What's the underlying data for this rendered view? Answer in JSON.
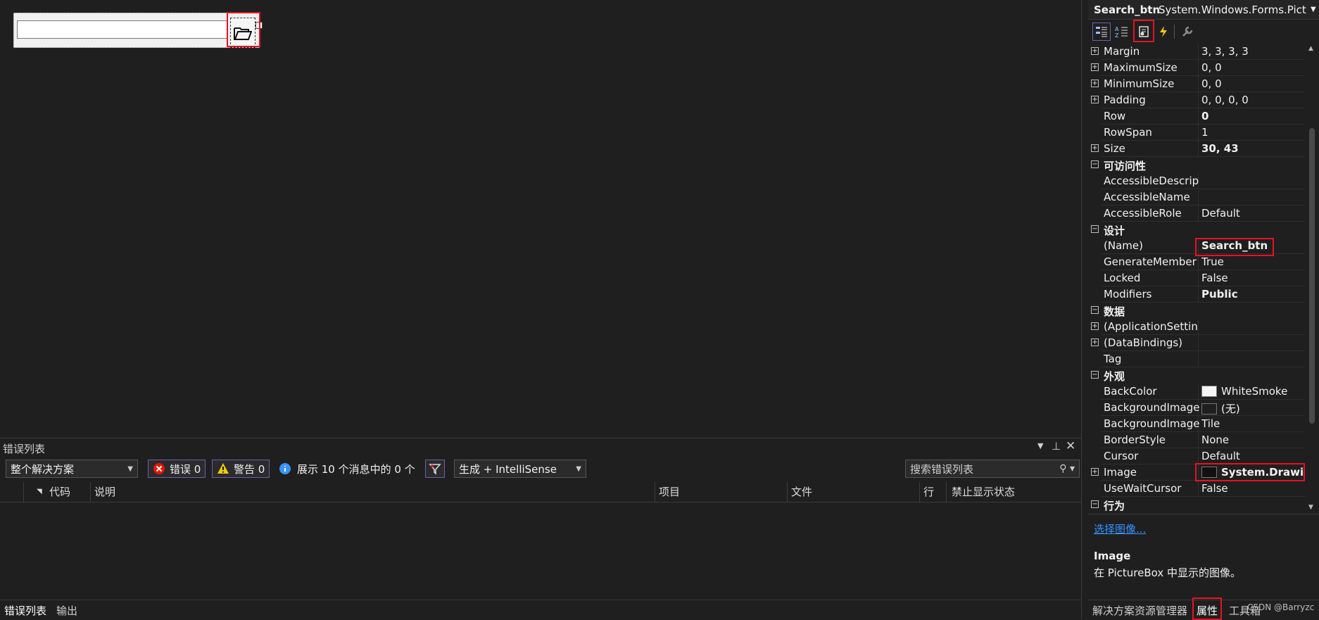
{
  "designer": {
    "folder_icon": "folder-open-icon"
  },
  "error_list": {
    "title": "错误列表",
    "scope_dropdown": "整个解决方案",
    "errors_label": "错误 0",
    "warnings_label": "警告 0",
    "messages_label": "展示 10 个消息中的 0 个",
    "build_dropdown": "生成 + IntelliSense",
    "search_placeholder": "搜索错误列表",
    "columns": [
      "代码",
      "说明",
      "项目",
      "文件",
      "行",
      "禁止显示状态"
    ]
  },
  "bottom_tabs": [
    "错误列表",
    "输出"
  ],
  "properties": {
    "object_name": "Search_btn",
    "object_type": "System.Windows.Forms.Pict",
    "rows": [
      {
        "kind": "item",
        "expand": true,
        "name": "Margin",
        "value": "3, 3, 3, 3"
      },
      {
        "kind": "item",
        "expand": true,
        "name": "MaximumSize",
        "value": "0, 0"
      },
      {
        "kind": "item",
        "expand": true,
        "name": "MinimumSize",
        "value": "0, 0"
      },
      {
        "kind": "item",
        "expand": true,
        "name": "Padding",
        "value": "0, 0, 0, 0"
      },
      {
        "kind": "item",
        "expand": false,
        "name": "Row",
        "value": "0",
        "bold": true
      },
      {
        "kind": "item",
        "expand": false,
        "name": "RowSpan",
        "value": "1"
      },
      {
        "kind": "item",
        "expand": true,
        "name": "Size",
        "value": "30, 43",
        "bold": true
      },
      {
        "kind": "cat",
        "name": "可访问性"
      },
      {
        "kind": "item",
        "expand": false,
        "name": "AccessibleDescrip",
        "value": ""
      },
      {
        "kind": "item",
        "expand": false,
        "name": "AccessibleName",
        "value": ""
      },
      {
        "kind": "item",
        "expand": false,
        "name": "AccessibleRole",
        "value": "Default"
      },
      {
        "kind": "cat",
        "name": "设计"
      },
      {
        "kind": "item",
        "expand": false,
        "name": "(Name)",
        "value": "Search_btn",
        "bold": true
      },
      {
        "kind": "item",
        "expand": false,
        "name": "GenerateMember",
        "value": "True"
      },
      {
        "kind": "item",
        "expand": false,
        "name": "Locked",
        "value": "False"
      },
      {
        "kind": "item",
        "expand": false,
        "name": "Modifiers",
        "value": "Public",
        "bold": true
      },
      {
        "kind": "cat",
        "name": "数据"
      },
      {
        "kind": "item",
        "expand": true,
        "name": "(ApplicationSettin",
        "value": ""
      },
      {
        "kind": "item",
        "expand": true,
        "name": "(DataBindings)",
        "value": ""
      },
      {
        "kind": "item",
        "expand": false,
        "name": "Tag",
        "value": ""
      },
      {
        "kind": "cat",
        "name": "外观"
      },
      {
        "kind": "item",
        "expand": false,
        "name": "BackColor",
        "value": "WhiteSmoke",
        "swatch": "#f5f5f5"
      },
      {
        "kind": "item",
        "expand": false,
        "name": "BackgroundImage",
        "value": "(无)",
        "swatch": "#1f1f1f"
      },
      {
        "kind": "item",
        "expand": false,
        "name": "BackgroundImage",
        "value": "Tile"
      },
      {
        "kind": "item",
        "expand": false,
        "name": "BorderStyle",
        "value": "None"
      },
      {
        "kind": "item",
        "expand": false,
        "name": "Cursor",
        "value": "Default"
      },
      {
        "kind": "item",
        "expand": true,
        "name": "Image",
        "value": "System.Drawin",
        "bold": true,
        "swatch": "#111111"
      },
      {
        "kind": "item",
        "expand": false,
        "name": "UseWaitCursor",
        "value": "False"
      },
      {
        "kind": "cat",
        "name": "行为"
      }
    ],
    "description_link": "选择图像...",
    "description_title": "Image",
    "description_text": "在 PictureBox 中显示的图像。"
  },
  "right_tabs": [
    "解决方案资源管理器",
    "属性",
    "工具箱"
  ],
  "watermark": "CSDN @Barryzc",
  "colors": {
    "highlight": "#e81123",
    "accent": "#6b5fb0",
    "link": "#3794ff"
  }
}
